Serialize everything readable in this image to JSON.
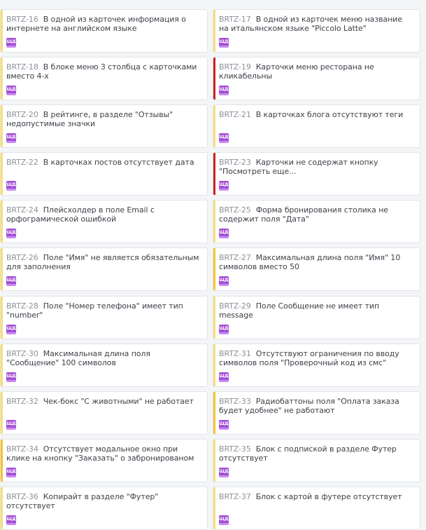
{
  "colors": {
    "low": "#f7df7a",
    "medium": "#f4c430",
    "high": "#cc1f1f",
    "tag": "#a24fd6"
  },
  "cards": [
    {
      "key": "BRTZ-16",
      "title": "В одной из карточек информация о интернете на английском языке",
      "priority": "low",
      "tag": "ЩД"
    },
    {
      "key": "BRTZ-17",
      "title": "В одной из карточек меню название на итальянском языке \"Piccolo Latte\"",
      "priority": "low",
      "tag": "ЩД"
    },
    {
      "key": "BRTZ-18",
      "title": "В блоке меню 3 столбца с карточками вместо 4-х",
      "priority": "low",
      "tag": "ЩД"
    },
    {
      "key": "BRTZ-19",
      "title": "Карточки меню ресторана не кликабельны",
      "priority": "high",
      "tag": "ЩД"
    },
    {
      "key": "BRTZ-20",
      "title": "В рейтинге, в разделе \"Отзывы\" недопустимые значки",
      "priority": "low",
      "tag": "ЩД"
    },
    {
      "key": "BRTZ-21",
      "title": "В карточках блога отсутствуют теги",
      "priority": "low",
      "tag": "ЩД"
    },
    {
      "key": "BRTZ-22",
      "title": "В карточках постов отсутствует дата",
      "priority": "low",
      "tag": "ЩД"
    },
    {
      "key": "BRTZ-23",
      "title": "Карточки не содержат кнопку \"Посмотреть еще...",
      "priority": "high",
      "tag": "ЩД"
    },
    {
      "key": "BRTZ-24",
      "title": "Плейсхолдер в поле Email с орфограмической ошибкой",
      "priority": "low",
      "tag": "ЩД"
    },
    {
      "key": "BRTZ-25",
      "title": "Форма бронирования столика не содержит поля \"Дата\"",
      "priority": "low",
      "tag": "ЩД"
    },
    {
      "key": "BRTZ-26",
      "title": "Поле \"Имя\" не является обязательным для заполнения",
      "priority": "low",
      "tag": "ЩД"
    },
    {
      "key": "BRTZ-27",
      "title": "Максимальная длина поля \"Имя\" 10 символов вместо 50",
      "priority": "medium",
      "tag": "ЩД"
    },
    {
      "key": "BRTZ-28",
      "title": "Поле \"Номер телефона\" имеет тип \"number\"",
      "priority": "low",
      "tag": "ЩД"
    },
    {
      "key": "BRTZ-29",
      "title": "Поле Сообщение не имеет тип message",
      "priority": "low",
      "tag": "ЩД"
    },
    {
      "key": "BRTZ-30",
      "title": "Максимальная длина поля \"Сообщение\" 100 символов",
      "priority": "low",
      "tag": "ЩД"
    },
    {
      "key": "BRTZ-31",
      "title": "Отсутствуют ограничения по вводу символов поля \"Проверочный код из смс\"",
      "priority": "low",
      "tag": "ЩД"
    },
    {
      "key": "BRTZ-32",
      "title": "Чек-бокс \"С животными\" не работает",
      "priority": "low",
      "tag": "ЩД"
    },
    {
      "key": "BRTZ-33",
      "title": "Радиобаттоны поля \"Оплата заказа будет удобнее\" не работают",
      "priority": "medium",
      "tag": "ЩД"
    },
    {
      "key": "BRTZ-34",
      "title": "Отсутствует модальное окно при клике на кнопку \"Заказать\" о забронированом столике",
      "priority": "medium",
      "tag": "ЩД"
    },
    {
      "key": "BRTZ-35",
      "title": "Блок с подпиской в разделе Футер отсутствует",
      "priority": "low",
      "tag": "ЩД"
    },
    {
      "key": "BRTZ-36",
      "title": "Копирайт в разделе \"Футер\" отсутствует",
      "priority": "low",
      "tag": "ЩД"
    },
    {
      "key": "BRTZ-37",
      "title": "Блок с картой в футере отсутствует",
      "priority": "low",
      "tag": "ЩД"
    }
  ]
}
